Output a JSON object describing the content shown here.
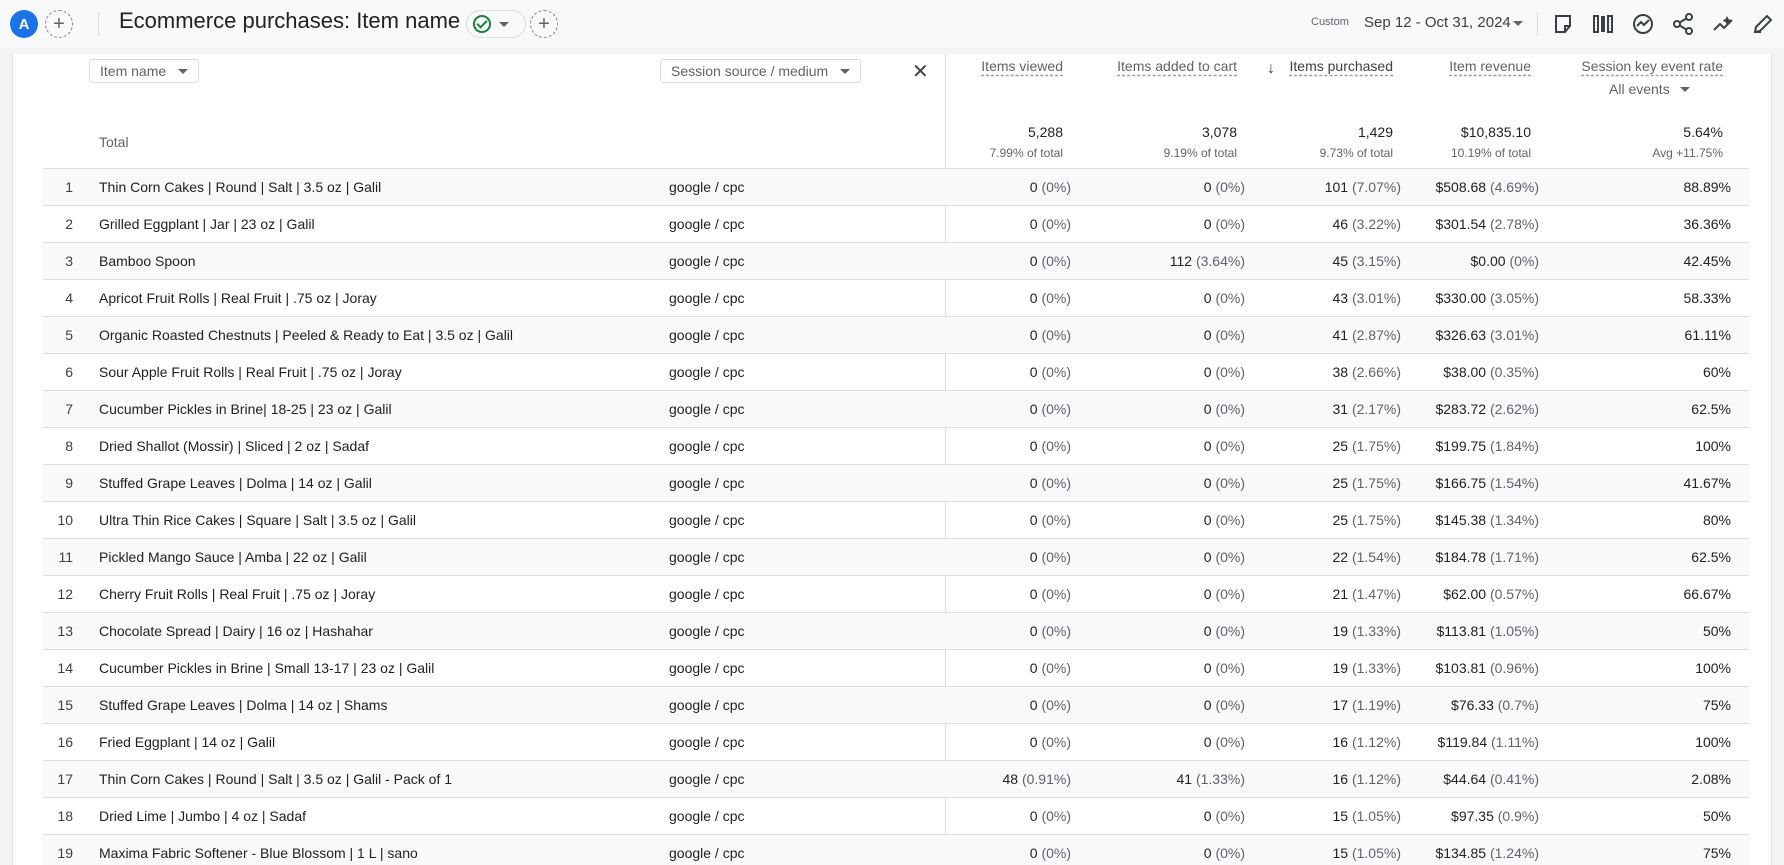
{
  "header": {
    "avatar_letter": "A",
    "title": "Ecommerce purchases: Item name",
    "date_label": "Custom",
    "date_range": "Sep 12 - Oct 31, 2024"
  },
  "table": {
    "dim1": "Item name",
    "dim2": "Session source / medium",
    "metrics": [
      "Items viewed",
      "Items added to cart",
      "Items purchased",
      "Item revenue",
      "Session key event rate"
    ],
    "key_event_filter": "All events",
    "total": {
      "label": "Total",
      "values": [
        "5,288",
        "3,078",
        "1,429",
        "$10,835.10",
        "5.64%"
      ],
      "pcts": [
        "7.99% of total",
        "9.19% of total",
        "9.73% of total",
        "10.19% of total",
        "Avg +11.75%"
      ]
    },
    "rows": [
      {
        "idx": "1",
        "name": "Thin Corn Cakes | Round | Salt | 3.5 oz | Galil",
        "src": "google / cpc",
        "viewed": "0",
        "viewed_pct": "(0%)",
        "cart": "0",
        "cart_pct": "(0%)",
        "purchased": "101",
        "purchased_pct": "(7.07%)",
        "revenue": "$508.68",
        "revenue_pct": "(4.69%)",
        "rate": "88.89%"
      },
      {
        "idx": "2",
        "name": "Grilled Eggplant | Jar | 23 oz | Galil",
        "src": "google / cpc",
        "viewed": "0",
        "viewed_pct": "(0%)",
        "cart": "0",
        "cart_pct": "(0%)",
        "purchased": "46",
        "purchased_pct": "(3.22%)",
        "revenue": "$301.54",
        "revenue_pct": "(2.78%)",
        "rate": "36.36%"
      },
      {
        "idx": "3",
        "name": "Bamboo Spoon",
        "src": "google / cpc",
        "viewed": "0",
        "viewed_pct": "(0%)",
        "cart": "112",
        "cart_pct": "(3.64%)",
        "purchased": "45",
        "purchased_pct": "(3.15%)",
        "revenue": "$0.00",
        "revenue_pct": "(0%)",
        "rate": "42.45%"
      },
      {
        "idx": "4",
        "name": "Apricot Fruit Rolls | Real Fruit | .75 oz | Joray",
        "src": "google / cpc",
        "viewed": "0",
        "viewed_pct": "(0%)",
        "cart": "0",
        "cart_pct": "(0%)",
        "purchased": "43",
        "purchased_pct": "(3.01%)",
        "revenue": "$330.00",
        "revenue_pct": "(3.05%)",
        "rate": "58.33%"
      },
      {
        "idx": "5",
        "name": "Organic Roasted Chestnuts | Peeled & Ready to Eat | 3.5 oz | Galil",
        "src": "google / cpc",
        "viewed": "0",
        "viewed_pct": "(0%)",
        "cart": "0",
        "cart_pct": "(0%)",
        "purchased": "41",
        "purchased_pct": "(2.87%)",
        "revenue": "$326.63",
        "revenue_pct": "(3.01%)",
        "rate": "61.11%"
      },
      {
        "idx": "6",
        "name": "Sour Apple Fruit Rolls | Real Fruit | .75 oz | Joray",
        "src": "google / cpc",
        "viewed": "0",
        "viewed_pct": "(0%)",
        "cart": "0",
        "cart_pct": "(0%)",
        "purchased": "38",
        "purchased_pct": "(2.66%)",
        "revenue": "$38.00",
        "revenue_pct": "(0.35%)",
        "rate": "60%"
      },
      {
        "idx": "7",
        "name": "Cucumber Pickles in Brine| 18-25 | 23 oz | Galil",
        "src": "google / cpc",
        "viewed": "0",
        "viewed_pct": "(0%)",
        "cart": "0",
        "cart_pct": "(0%)",
        "purchased": "31",
        "purchased_pct": "(2.17%)",
        "revenue": "$283.72",
        "revenue_pct": "(2.62%)",
        "rate": "62.5%"
      },
      {
        "idx": "8",
        "name": "Dried Shallot (Mossir) | Sliced | 2 oz | Sadaf",
        "src": "google / cpc",
        "viewed": "0",
        "viewed_pct": "(0%)",
        "cart": "0",
        "cart_pct": "(0%)",
        "purchased": "25",
        "purchased_pct": "(1.75%)",
        "revenue": "$199.75",
        "revenue_pct": "(1.84%)",
        "rate": "100%"
      },
      {
        "idx": "9",
        "name": "Stuffed Grape Leaves | Dolma | 14 oz | Galil",
        "src": "google / cpc",
        "viewed": "0",
        "viewed_pct": "(0%)",
        "cart": "0",
        "cart_pct": "(0%)",
        "purchased": "25",
        "purchased_pct": "(1.75%)",
        "revenue": "$166.75",
        "revenue_pct": "(1.54%)",
        "rate": "41.67%"
      },
      {
        "idx": "10",
        "name": "Ultra Thin Rice Cakes | Square | Salt | 3.5 oz | Galil",
        "src": "google / cpc",
        "viewed": "0",
        "viewed_pct": "(0%)",
        "cart": "0",
        "cart_pct": "(0%)",
        "purchased": "25",
        "purchased_pct": "(1.75%)",
        "revenue": "$145.38",
        "revenue_pct": "(1.34%)",
        "rate": "80%"
      },
      {
        "idx": "11",
        "name": "Pickled Mango Sauce | Amba | 22 oz | Galil",
        "src": "google / cpc",
        "viewed": "0",
        "viewed_pct": "(0%)",
        "cart": "0",
        "cart_pct": "(0%)",
        "purchased": "22",
        "purchased_pct": "(1.54%)",
        "revenue": "$184.78",
        "revenue_pct": "(1.71%)",
        "rate": "62.5%"
      },
      {
        "idx": "12",
        "name": "Cherry Fruit Rolls | Real Fruit | .75 oz | Joray",
        "src": "google / cpc",
        "viewed": "0",
        "viewed_pct": "(0%)",
        "cart": "0",
        "cart_pct": "(0%)",
        "purchased": "21",
        "purchased_pct": "(1.47%)",
        "revenue": "$62.00",
        "revenue_pct": "(0.57%)",
        "rate": "66.67%"
      },
      {
        "idx": "13",
        "name": "Chocolate Spread | Dairy | 16 oz | Hashahar",
        "src": "google / cpc",
        "viewed": "0",
        "viewed_pct": "(0%)",
        "cart": "0",
        "cart_pct": "(0%)",
        "purchased": "19",
        "purchased_pct": "(1.33%)",
        "revenue": "$113.81",
        "revenue_pct": "(1.05%)",
        "rate": "50%"
      },
      {
        "idx": "14",
        "name": "Cucumber Pickles in Brine | Small 13-17 | 23 oz | Galil",
        "src": "google / cpc",
        "viewed": "0",
        "viewed_pct": "(0%)",
        "cart": "0",
        "cart_pct": "(0%)",
        "purchased": "19",
        "purchased_pct": "(1.33%)",
        "revenue": "$103.81",
        "revenue_pct": "(0.96%)",
        "rate": "100%"
      },
      {
        "idx": "15",
        "name": "Stuffed Grape Leaves | Dolma | 14 oz | Shams",
        "src": "google / cpc",
        "viewed": "0",
        "viewed_pct": "(0%)",
        "cart": "0",
        "cart_pct": "(0%)",
        "purchased": "17",
        "purchased_pct": "(1.19%)",
        "revenue": "$76.33",
        "revenue_pct": "(0.7%)",
        "rate": "75%"
      },
      {
        "idx": "16",
        "name": "Fried Eggplant | 14 oz | Galil",
        "src": "google / cpc",
        "viewed": "0",
        "viewed_pct": "(0%)",
        "cart": "0",
        "cart_pct": "(0%)",
        "purchased": "16",
        "purchased_pct": "(1.12%)",
        "revenue": "$119.84",
        "revenue_pct": "(1.11%)",
        "rate": "100%"
      },
      {
        "idx": "17",
        "name": "Thin Corn Cakes | Round | Salt | 3.5 oz | Galil - Pack of 1",
        "src": "google / cpc",
        "viewed": "48",
        "viewed_pct": "(0.91%)",
        "cart": "41",
        "cart_pct": "(1.33%)",
        "purchased": "16",
        "purchased_pct": "(1.12%)",
        "revenue": "$44.64",
        "revenue_pct": "(0.41%)",
        "rate": "2.08%"
      },
      {
        "idx": "18",
        "name": "Dried Lime | Jumbo | 4 oz | Sadaf",
        "src": "google / cpc",
        "viewed": "0",
        "viewed_pct": "(0%)",
        "cart": "0",
        "cart_pct": "(0%)",
        "purchased": "15",
        "purchased_pct": "(1.05%)",
        "revenue": "$97.35",
        "revenue_pct": "(0.9%)",
        "rate": "50%"
      },
      {
        "idx": "19",
        "name": "Maxima Fabric Softener - Blue Blossom | 1 L | sano",
        "src": "google / cpc",
        "viewed": "0",
        "viewed_pct": "(0%)",
        "cart": "0",
        "cart_pct": "(0%)",
        "purchased": "15",
        "purchased_pct": "(1.05%)",
        "revenue": "$134.85",
        "revenue_pct": "(1.24%)",
        "rate": "75%"
      }
    ]
  },
  "icons": {
    "toolbar": [
      "compare-icon",
      "columns-icon",
      "insights-icon",
      "share-icon",
      "trend-icon",
      "edit-icon"
    ]
  }
}
